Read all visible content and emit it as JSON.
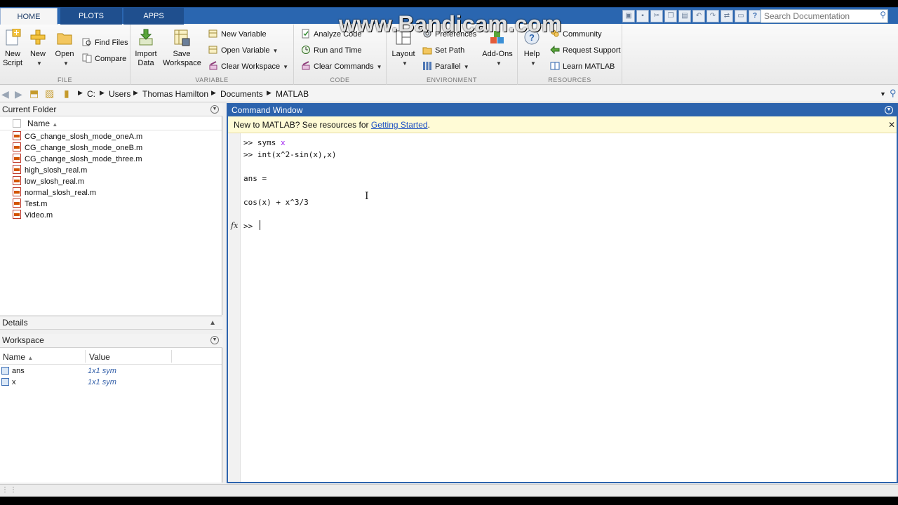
{
  "watermark": "www.Bandicam.com",
  "tabs": [
    {
      "label": "HOME"
    },
    {
      "label": "PLOTS"
    },
    {
      "label": "APPS"
    }
  ],
  "search": {
    "placeholder": "Search Documentation"
  },
  "ribbon": {
    "file": {
      "section_label": "FILE",
      "new_script": [
        "New",
        "Script"
      ],
      "new": "New",
      "open": "Open",
      "find_files": "Find Files",
      "compare": "Compare"
    },
    "variable": {
      "section_label": "VARIABLE",
      "import_data": [
        "Import",
        "Data"
      ],
      "save_workspace": [
        "Save",
        "Workspace"
      ],
      "new_variable": "New Variable",
      "open_variable": "Open Variable",
      "clear_workspace": "Clear Workspace"
    },
    "code": {
      "section_label": "CODE",
      "analyze_code": "Analyze Code",
      "run_and_time": "Run and Time",
      "clear_commands": "Clear Commands"
    },
    "environment": {
      "section_label": "ENVIRONMENT",
      "layout": "Layout",
      "preferences": "Preferences",
      "set_path": "Set Path",
      "parallel": "Parallel",
      "add_ons": "Add-Ons"
    },
    "resources": {
      "section_label": "RESOURCES",
      "help": "Help",
      "community": "Community",
      "request_support": "Request Support",
      "learn_matlab": "Learn MATLAB"
    }
  },
  "path": [
    "C:",
    "Users",
    "Thomas Hamilton",
    "Documents",
    "MATLAB"
  ],
  "current_folder": {
    "title": "Current Folder",
    "column_name": "Name",
    "files": [
      "CG_change_slosh_mode_oneA.m",
      "CG_change_slosh_mode_oneB.m",
      "CG_change_slosh_mode_three.m",
      "high_slosh_real.m",
      "low_slosh_real.m",
      "normal_slosh_real.m",
      "Test.m",
      "Video.m"
    ]
  },
  "details": {
    "title": "Details"
  },
  "workspace": {
    "title": "Workspace",
    "col_name": "Name",
    "col_value": "Value",
    "vars": [
      {
        "name": "ans",
        "value": "1x1 sym"
      },
      {
        "name": "x",
        "value": "1x1 sym"
      }
    ]
  },
  "command_window": {
    "title": "Command Window",
    "info_text": "New to MATLAB? See resources for ",
    "info_link": "Getting Started",
    "info_end": ".",
    "lines": {
      "l1_prompt": ">> syms ",
      "l1_arg": "x",
      "l2": ">> int(x^2-sin(x),x)",
      "l3": "ans =",
      "l4": "cos(x) + x^3/3",
      "prompt": ">>"
    },
    "fx": "fx"
  }
}
